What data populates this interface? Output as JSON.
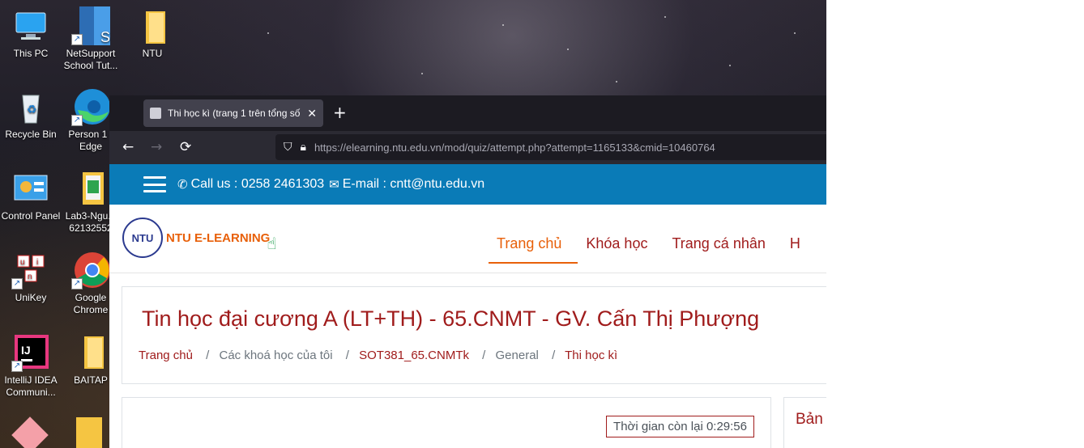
{
  "desktop": {
    "icons": [
      {
        "label": "This PC",
        "icon": "computer-icon"
      },
      {
        "label": "NetSupport School Tut...",
        "icon": "netsupport-icon"
      },
      {
        "label": "NTU",
        "icon": "folder-icon"
      },
      {
        "label": "Recycle Bin",
        "icon": "recycle-bin-icon"
      },
      {
        "label": "Person 1 - Edge",
        "icon": "edge-icon"
      },
      {
        "label": "Control Panel",
        "icon": "control-panel-icon"
      },
      {
        "label": "Lab3-Ngu... 62132552",
        "icon": "folder-icon"
      },
      {
        "label": "UniKey",
        "icon": "unikey-icon"
      },
      {
        "label": "Google Chrome",
        "icon": "chrome-icon"
      },
      {
        "label": "IntelliJ IDEA Communi...",
        "icon": "intellij-icon"
      },
      {
        "label": "BAITAP",
        "icon": "folder-icon"
      }
    ]
  },
  "browser": {
    "tab_title": "Thi học kì (trang 1 trên tổng số",
    "tab_close": "✕",
    "new_tab": "+",
    "url": "https://elearning.ntu.edu.vn/mod/quiz/attempt.php?attempt=1165133&cmid=10460764"
  },
  "page": {
    "infobar": {
      "call": "Call us : 0258 2461303",
      "email": "E-mail : cntt@ntu.edu.vn"
    },
    "logo": {
      "mark": "NTU",
      "name": "NTU E-LEARNING"
    },
    "menu": [
      "Trang chủ",
      "Khóa học",
      "Trang cá nhân",
      "H"
    ],
    "course_title": "Tin học đại cương A (LT+TH) - 65.CNMT - GV. Cấn Thị Phượng",
    "breadcrumb": [
      "Trang chủ",
      "Các khoá học của tôi",
      "SOT381_65.CNMTk",
      "General",
      "Thi học kì"
    ],
    "timer": "Thời gian còn lại 0:29:56",
    "side_title": "Bản"
  },
  "colors": {
    "brand_blue": "#0a7bb7",
    "brand_red": "#a01c1c",
    "active_orange": "#e8600a"
  }
}
